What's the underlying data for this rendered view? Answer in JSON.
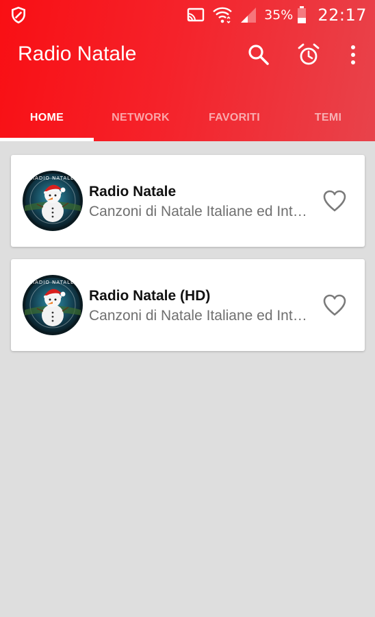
{
  "status_bar": {
    "battery": "35%",
    "time": "22:17",
    "icons": [
      "shield-icon",
      "cast-icon",
      "wifi-icon",
      "signal-icon",
      "battery-icon"
    ]
  },
  "toolbar": {
    "title": "Radio Natale",
    "icons": [
      "search-icon",
      "alarm-icon",
      "more-vert-icon"
    ]
  },
  "tabs": [
    {
      "label": "HOME",
      "active": true
    },
    {
      "label": "NETWORK",
      "active": false
    },
    {
      "label": "FAVORITI",
      "active": false
    },
    {
      "label": "TEMI",
      "active": false
    }
  ],
  "stations": [
    {
      "name": "Radio Natale",
      "description": "Canzoni di Natale Italiane ed Internazionali",
      "logo_text": "RADIO NATALE",
      "favorite": false
    },
    {
      "name": "Radio Natale (HD)",
      "description": "Canzoni di Natale Italiane ed Internazionali",
      "logo_text": "RADIO NATALE",
      "favorite": false
    }
  ],
  "colors": {
    "primary": "#f90f14",
    "primary_end": "#e8434b",
    "background": "#dedede",
    "card": "#ffffff",
    "subtitle": "#6f6f6f",
    "icon_gray": "#7a7a7a"
  }
}
